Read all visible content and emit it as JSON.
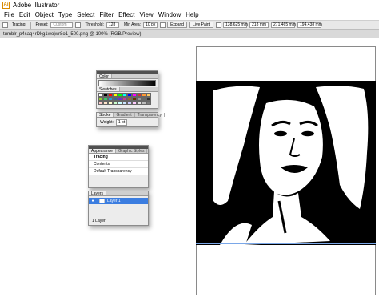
{
  "app": {
    "title": "Adobe Illustrator"
  },
  "menu": [
    "File",
    "Edit",
    "Object",
    "Type",
    "Select",
    "Filter",
    "Effect",
    "View",
    "Window",
    "Help"
  ],
  "control": {
    "object_label": "Tracing",
    "preset_label": "Preset:",
    "preset_value": "Custom",
    "threshold_label": "Threshold:",
    "threshold_value": "128",
    "min_area_label": "Min Area:",
    "min_area_value": "10 px",
    "expand_label": "Expand",
    "live_paint_label": "Live Paint",
    "x_value": "138.625 mm",
    "y_value": "218 mm",
    "w_value": "271.465 mm",
    "h_value": "194.438 mm"
  },
  "document": {
    "tab_title": "tumblr_p4saq4rDkg1wojwr8o1_500.png @ 100% (RGB/Preview)"
  },
  "color_panel": {
    "tabs": [
      "Color",
      "Swatches"
    ],
    "swatch_colors": [
      "#ffffff",
      "#000000",
      "#ff0000",
      "#ffff00",
      "#00ff00",
      "#00ffff",
      "#0000ff",
      "#ff00ff",
      "#cc3333",
      "#ff9933",
      "#ffcc66",
      "#99cc33",
      "#33cc66",
      "#3399cc",
      "#336699",
      "#6633cc",
      "#cc3399",
      "#996633",
      "#663300",
      "#999999",
      "#666666",
      "#333333",
      "#ffcccc",
      "#ffe5cc",
      "#ffffcc",
      "#ccffcc",
      "#ccffff",
      "#cce5ff",
      "#ccccff",
      "#ffccff",
      "#e0e0e0",
      "#bdbdbd",
      "#7a7a7a"
    ]
  },
  "stroke_panel": {
    "tabs": [
      "Stroke",
      "Gradient",
      "Transparency"
    ],
    "weight_label": "Weight:",
    "weight_value": "1 pt"
  },
  "appearance_panel": {
    "tabs": [
      "Appearance",
      "Graphic Styles"
    ],
    "items": [
      "Tracing",
      "Contents",
      "Default Transparency"
    ]
  },
  "layers_panel": {
    "tabs": [
      "Layers"
    ],
    "layer_name": "Layer 1",
    "footer": "1 Layer"
  },
  "colors": {
    "selection": "#3b7de0",
    "titlebar_icon": "#d98a00"
  }
}
